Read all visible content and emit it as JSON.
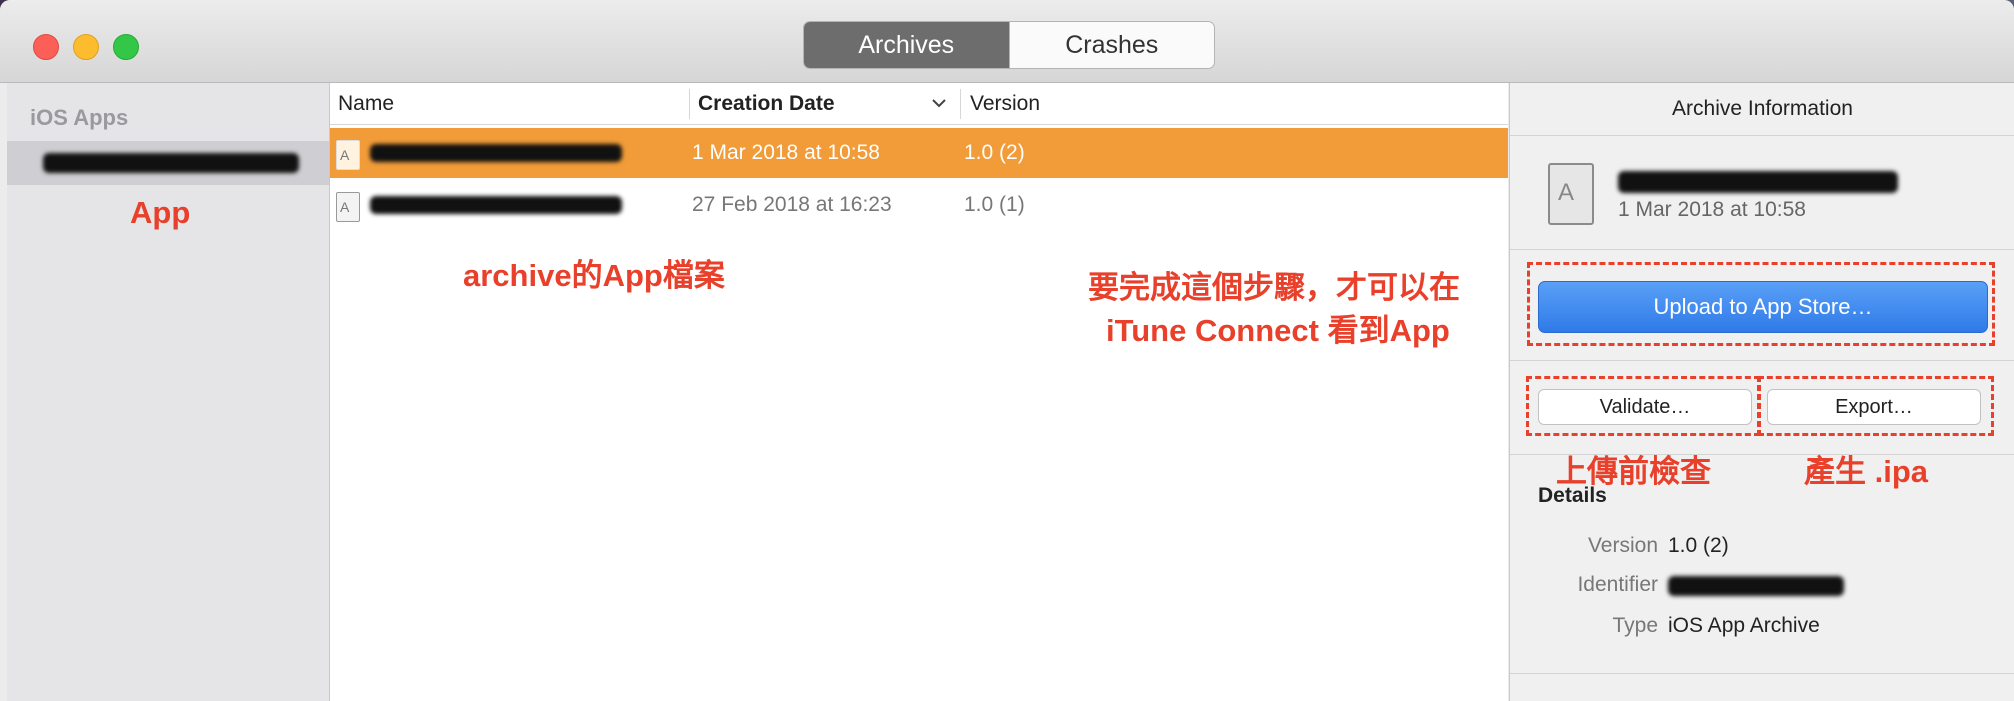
{
  "window": {
    "tabs": [
      {
        "label": "Archives",
        "active": true
      },
      {
        "label": "Crashes",
        "active": false
      }
    ]
  },
  "sidebar": {
    "header": "iOS Apps"
  },
  "list": {
    "columns": [
      "Name",
      "Creation Date",
      "Version"
    ],
    "rows": [
      {
        "date": "1 Mar 2018 at 10:58",
        "version": "1.0 (2)",
        "selected": true
      },
      {
        "date": "27 Feb 2018 at 16:23",
        "version": "1.0 (1)",
        "selected": false
      }
    ]
  },
  "inspector": {
    "title": "Archive Information",
    "archive_date": "1 Mar 2018 at 10:58",
    "upload_button": "Upload to App Store…",
    "validate_button": "Validate…",
    "export_button": "Export…",
    "details_title": "Details",
    "details": [
      {
        "key": "Version",
        "value": "1.0 (2)"
      },
      {
        "key": "Identifier",
        "value": ""
      },
      {
        "key": "Type",
        "value": "iOS App Archive"
      }
    ]
  },
  "annotations": {
    "app": "App",
    "archive_file": "archive的App檔案",
    "upload_note_line1": "要完成這個步驟，才可以在",
    "upload_note_line2": "iTune Connect 看到App",
    "validate_note": "上傳前檢查",
    "export_note": "產生 .ipa"
  },
  "colors": {
    "selection": "#f19c39",
    "primary_button": "#2f7ae8",
    "annotation": "#e8402a"
  }
}
